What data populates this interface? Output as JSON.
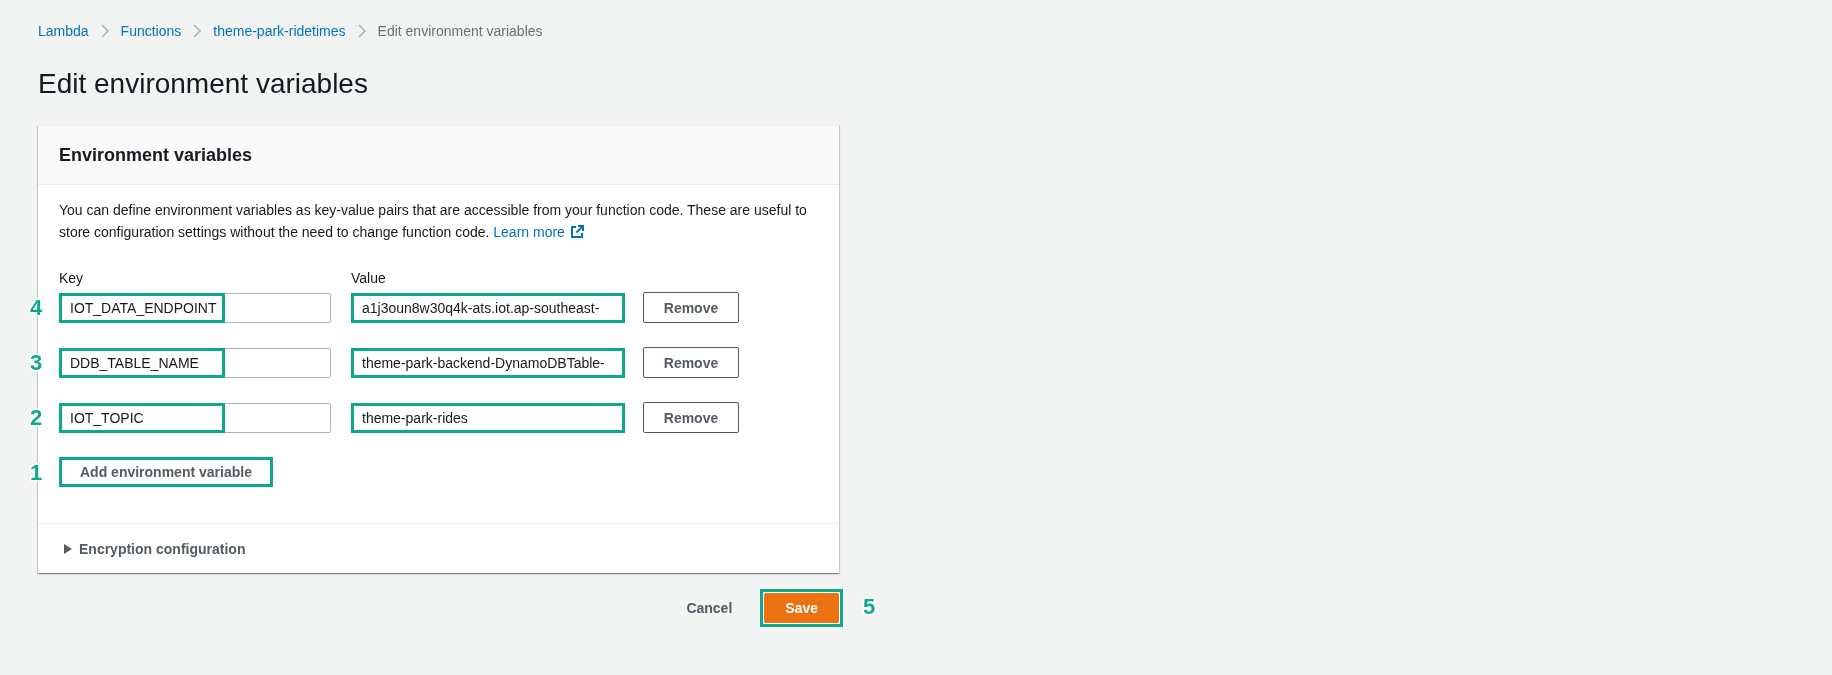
{
  "breadcrumbs": [
    {
      "label": "Lambda",
      "current": false
    },
    {
      "label": "Functions",
      "current": false
    },
    {
      "label": "theme-park-ridetimes",
      "current": false
    },
    {
      "label": "Edit environment variables",
      "current": true
    }
  ],
  "page_title": "Edit environment variables",
  "panel": {
    "title": "Environment variables",
    "description": "You can define environment variables as key-value pairs that are accessible from your function code. These are useful to store configuration settings without the need to change function code.",
    "learn_more_link": "Learn more",
    "key_label": "Key",
    "value_label": "Value",
    "variables": [
      {
        "key": "IOT_DATA_ENDPOINT",
        "value": "a1j3oun8w30q4k-ats.iot.ap-southeast-",
        "remove_button": "Remove",
        "highlighted": true,
        "callout": "4"
      },
      {
        "key": "DDB_TABLE_NAME",
        "value": "theme-park-backend-DynamoDBTable-",
        "remove_button": "Remove",
        "highlighted": true,
        "callout": "3"
      },
      {
        "key": "IOT_TOPIC",
        "value": "theme-park-rides",
        "remove_button": "Remove",
        "highlighted": true,
        "callout": "2"
      }
    ],
    "add_button": {
      "label": "Add environment variable",
      "highlighted": true,
      "callout": "1"
    },
    "encryption_section": {
      "label": "Encryption configuration",
      "expanded": false
    }
  },
  "footer": {
    "cancel_button": "Cancel",
    "save_button": {
      "label": "Save",
      "highlighted": true,
      "callout": "5"
    }
  }
}
